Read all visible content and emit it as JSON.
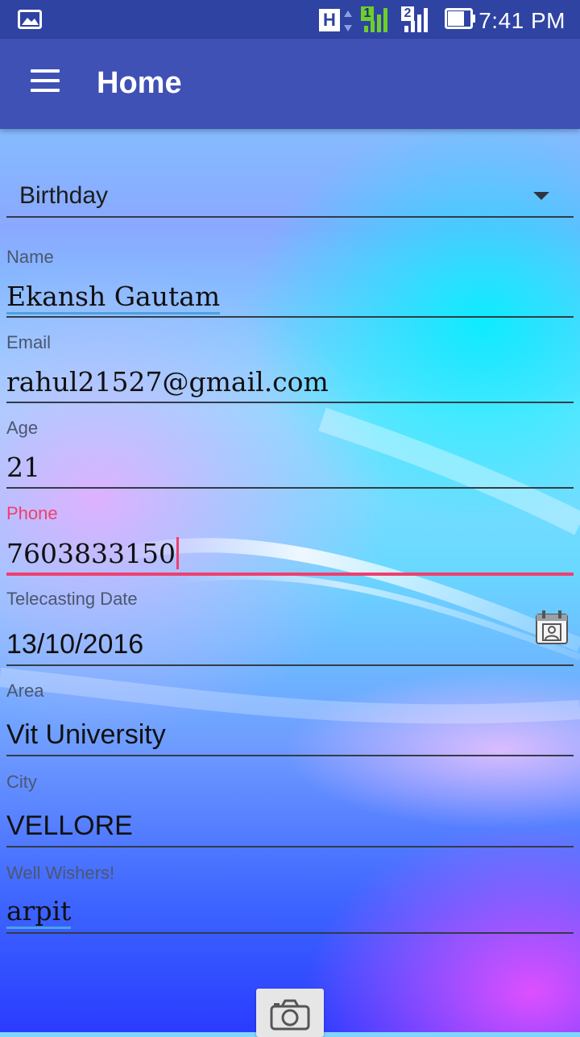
{
  "status_bar": {
    "time": "7:41 PM",
    "network_type": "H",
    "sim1_label": "1",
    "sim2_label": "2",
    "icons": [
      "gallery-notification-icon",
      "network-type-icon",
      "signal-sim1-icon",
      "signal-sim2-icon",
      "battery-icon"
    ]
  },
  "app_bar": {
    "title": "Home",
    "menu_icon": "hamburger-menu-icon",
    "color": "#3f51b5"
  },
  "form": {
    "occasion": {
      "selected": "Birthday"
    },
    "fields": [
      {
        "label": "Name",
        "value": "Ekansh Gautam"
      },
      {
        "label": "Email",
        "value": "rahul21527@gmail.com"
      },
      {
        "label": "Age",
        "value": "21"
      },
      {
        "label": "Phone",
        "value": "7603833150",
        "focused": true
      },
      {
        "label": "Telecasting Date",
        "value": "13/10/2016",
        "icon": "calendar-icon"
      },
      {
        "label": "Area",
        "value": "Vit University"
      },
      {
        "label": "City",
        "value": "VELLORE"
      },
      {
        "label": "Well Wishers!",
        "value": "arpit"
      }
    ],
    "accent_color": "#ef3f6f"
  },
  "camera_button": {
    "icon": "camera-icon"
  }
}
